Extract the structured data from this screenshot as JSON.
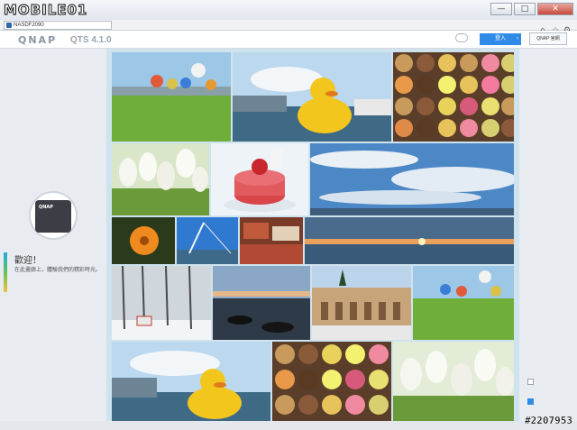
{
  "browser": {
    "brand": "MOBILE01",
    "tab_label": "NASDF2090",
    "window_buttons": {
      "minimize": "—",
      "maximize": "□",
      "close": "✕"
    }
  },
  "header": {
    "logo": "QNAP",
    "version": "QTS 4.1.0",
    "login_label": "登入",
    "qnap_site_label": "QNAP 官網"
  },
  "welcome": {
    "title": "歡迎！",
    "subtitle": "在此畫廊上，體驗我們的精彩時光。",
    "device_logo": "QNAP"
  },
  "gallery": {
    "photos": [
      "hot-air-balloons",
      "rubber-duck-harbor",
      "macarons-tray",
      "white-tulips",
      "macaron-cake",
      "blue-sky-clouds",
      "orange-flower",
      "bridge-sunny",
      "market-stalls",
      "sea-sunset",
      "snowy-forest",
      "coastal-rocks",
      "alhambra-courtyard",
      "hot-air-balloons-2",
      "rubber-duck-harbor-2",
      "macarons-tray-2",
      "white-tulips-2"
    ]
  },
  "checkboxes": [
    false,
    true
  ],
  "watermark": "#2207953"
}
